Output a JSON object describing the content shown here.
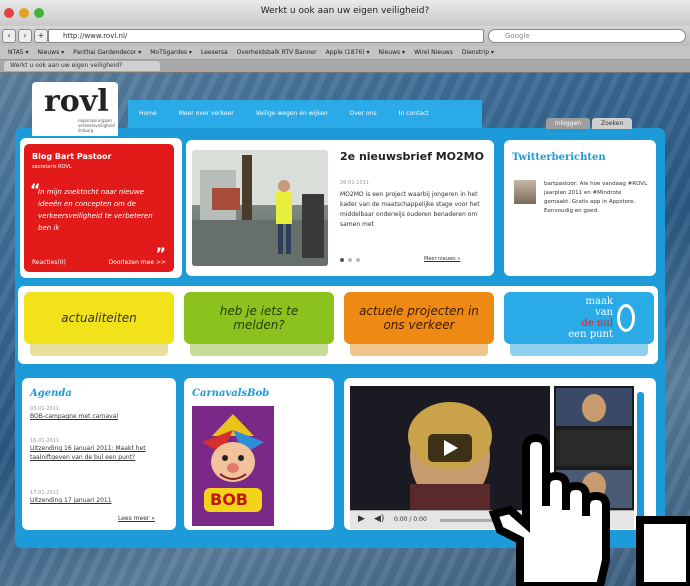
{
  "window": {
    "title": "Werkt u ook aan uw eigen veiligheid?"
  },
  "toolbar": {
    "url": "http://www.rovl.nl/",
    "search_placeholder": "Google"
  },
  "bookmarks": [
    "NTA5 ▾",
    "Nieuws ▾",
    "Panthai Gardendecor ▾",
    "MoTSgardes ▾",
    "Leesersa",
    "Overheidsbalk RTV Banner",
    "Apple (1876) ▾",
    "Nieuws ▾",
    "Wirel Nieuws",
    "Dienstrip ▾"
  ],
  "browser_tab": {
    "label": "Werkt u ook aan uw eigen veiligheid?"
  },
  "site": {
    "logo_text": "rovl",
    "logo_tagline": "regionaal orgaan verkeersveiligheid limburg",
    "nav": [
      "Home",
      "Meer over verkeer",
      "Veilige wegen en wijken",
      "Over ons",
      "In contact"
    ],
    "top_tabs": [
      "Inloggen",
      "Zoeken"
    ],
    "blog": {
      "title": "Blog Bart Pastoor",
      "subtitle": "secretaris ROVL",
      "quote": "In mijn zoektocht naar nieuwe ideeën en concepten om de verkeersveiligheid te verbeteren ben ik",
      "open_quote": "“",
      "close_quote": "”",
      "reactions": "Reacties(0)",
      "read_more": "Doorlezen mee >>"
    },
    "news": {
      "title": "2e nieuwsbrief MO2MO",
      "date": "26-01-2011",
      "body": "MO2MO is een project waarbij jongeren in het kader van de maatschappelijke stage voor het middelbaar onderwijs ouderen benaderen om samen met",
      "more": "Meer nieuws »"
    },
    "twitter": {
      "title": "Twitterberichten",
      "body": "bartpastoor: Ale hoe vandaag #ROVL jaarplan 2011 en #Mindrote gemaakt. Gratis app in Appstore. Eenvoudig en goed."
    },
    "cta": {
      "actualiteiten": "actualiteiten",
      "melden": "heb je iets te melden?",
      "projecten": "actuele projecten in ons verkeer",
      "nul_line1": "maak",
      "nul_line2": "van",
      "nul_line3": "de nul",
      "nul_line4": "een punt"
    },
    "agenda": {
      "title": "Agenda",
      "items": [
        {
          "date": "03-01-2011",
          "text": "BOB-campagne met carnaval"
        },
        {
          "date": "16-01-2011",
          "text": "Uitzending 16 januari 2011: Maakt het taalniftgeven van de bul een punt?"
        },
        {
          "date": "17-01-2011",
          "text": "Uitzending 17 januari 2011"
        }
      ],
      "more": "Lees meer »"
    },
    "carnaval": {
      "title": "CarnavalsBob",
      "poster_text": "BOB"
    },
    "video": {
      "time": "0:00 / 0:00"
    }
  },
  "colors": {
    "brand_blue": "#1d9ad8",
    "red": "#e21a1a",
    "yellow": "#f2e21a",
    "green": "#8cc21d",
    "orange": "#ee8a14",
    "cyan": "#2aaae6"
  }
}
